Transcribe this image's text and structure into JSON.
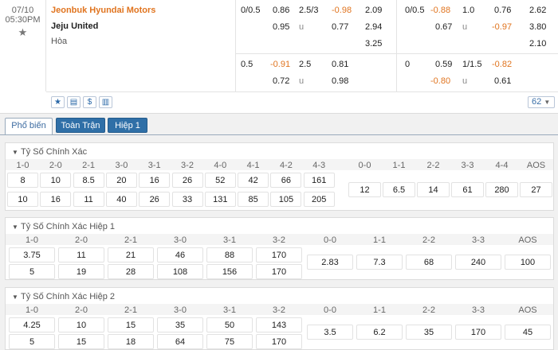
{
  "match": {
    "date": "07/10",
    "time": "05:30PM",
    "home": "Jeonbuk Hyundai Motors",
    "away": "Jeju United",
    "draw": "Hòa"
  },
  "odds_full": {
    "row1": [
      "0/0.5",
      "0.86",
      "2.5/3",
      "-0.98",
      "2.09",
      "0/0.5",
      "-0.88",
      "1.0",
      "0.76",
      "2.62"
    ],
    "row2": [
      "0.95",
      "u",
      "0.77",
      "2.94",
      "0.67",
      "u",
      "-0.97",
      "3.80"
    ],
    "row3": [
      "3.25",
      "2.10"
    ]
  },
  "odds_half": {
    "row1": [
      "0.5",
      "-0.91",
      "2.5",
      "0.81",
      "0",
      "0.59",
      "1/1.5",
      "-0.82"
    ],
    "row2": [
      "0.72",
      "u",
      "0.98",
      "-0.80",
      "u",
      "0.61"
    ]
  },
  "market_count": "62",
  "tabs": [
    "Phổ biến",
    "Toàn Trận",
    "Hiệp 1"
  ],
  "sections": [
    {
      "title": "Tỷ Số Chính Xác",
      "headers": [
        "1-0",
        "2-0",
        "2-1",
        "3-0",
        "3-1",
        "3-2",
        "4-0",
        "4-1",
        "4-2",
        "4-3",
        "0-0",
        "1-1",
        "2-2",
        "3-3",
        "4-4",
        "AOS"
      ],
      "row_home": [
        "8",
        "10",
        "8.5",
        "20",
        "16",
        "26",
        "52",
        "42",
        "66",
        "161"
      ],
      "row_away": [
        "10",
        "16",
        "11",
        "40",
        "26",
        "33",
        "131",
        "85",
        "105",
        "205"
      ],
      "draws": [
        "12",
        "6.5",
        "14",
        "61",
        "280",
        "27"
      ]
    },
    {
      "title": "Tỷ Số Chính Xác Hiệp 1",
      "headers": [
        "1-0",
        "2-0",
        "2-1",
        "3-0",
        "3-1",
        "3-2",
        "0-0",
        "1-1",
        "2-2",
        "3-3",
        "AOS"
      ],
      "row_home": [
        "3.75",
        "11",
        "21",
        "46",
        "88",
        "170"
      ],
      "row_away": [
        "5",
        "19",
        "28",
        "108",
        "156",
        "170"
      ],
      "draws": [
        "2.83",
        "7.3",
        "68",
        "240",
        "100"
      ]
    },
    {
      "title": "Tỷ Số Chính Xác Hiệp 2",
      "headers": [
        "1-0",
        "2-0",
        "2-1",
        "3-0",
        "3-1",
        "3-2",
        "0-0",
        "1-1",
        "2-2",
        "3-3",
        "AOS"
      ],
      "row_home": [
        "4.25",
        "10",
        "15",
        "35",
        "50",
        "143"
      ],
      "row_away": [
        "5",
        "15",
        "18",
        "64",
        "75",
        "170"
      ],
      "draws": [
        "3.5",
        "6.2",
        "35",
        "170",
        "45"
      ]
    }
  ],
  "colors": {
    "accent": "#2f6fa7",
    "negative": "#e0741f"
  },
  "icons": [
    "star-icon",
    "favorite-icon",
    "stats-icon",
    "currency-icon",
    "chart-icon",
    "chevron-down-icon"
  ]
}
